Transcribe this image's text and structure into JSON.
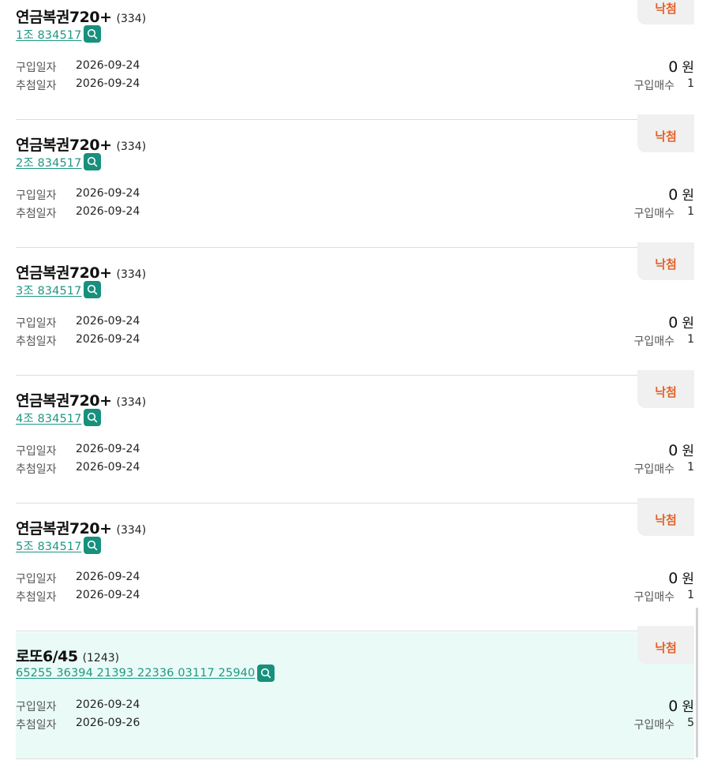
{
  "labels": {
    "purchase_date": "구입일자",
    "draw_date": "추첨일자",
    "purchase_count": "구입매수",
    "currency": "원"
  },
  "tickets": [
    {
      "status": "낙첨",
      "name": "연금복권720+",
      "round": "(334)",
      "number": "1조 834517",
      "purchase_date": "2026-09-24",
      "draw_date": "2026-09-24",
      "amount": "0",
      "count": "1"
    },
    {
      "status": "낙첨",
      "name": "연금복권720+",
      "round": "(334)",
      "number": "2조 834517",
      "purchase_date": "2026-09-24",
      "draw_date": "2026-09-24",
      "amount": "0",
      "count": "1"
    },
    {
      "status": "낙첨",
      "name": "연금복권720+",
      "round": "(334)",
      "number": "3조 834517",
      "purchase_date": "2026-09-24",
      "draw_date": "2026-09-24",
      "amount": "0",
      "count": "1"
    },
    {
      "status": "낙첨",
      "name": "연금복권720+",
      "round": "(334)",
      "number": "4조 834517",
      "purchase_date": "2026-09-24",
      "draw_date": "2026-09-24",
      "amount": "0",
      "count": "1"
    },
    {
      "status": "낙첨",
      "name": "연금복권720+",
      "round": "(334)",
      "number": "5조 834517",
      "purchase_date": "2026-09-24",
      "draw_date": "2026-09-24",
      "amount": "0",
      "count": "1"
    },
    {
      "status": "낙첨",
      "name": "로또6/45",
      "round": "(1243)",
      "number": "65255 36394 21393 22336 03117 25940",
      "purchase_date": "2026-09-24",
      "draw_date": "2026-09-26",
      "amount": "0",
      "count": "5"
    }
  ],
  "colors": {
    "accent": "#17907c",
    "link": "#1e9783",
    "status_lost": "#e2632b",
    "highlight_bg": "#eafbf7"
  },
  "icons": {
    "number_lookup": "search-icon"
  }
}
